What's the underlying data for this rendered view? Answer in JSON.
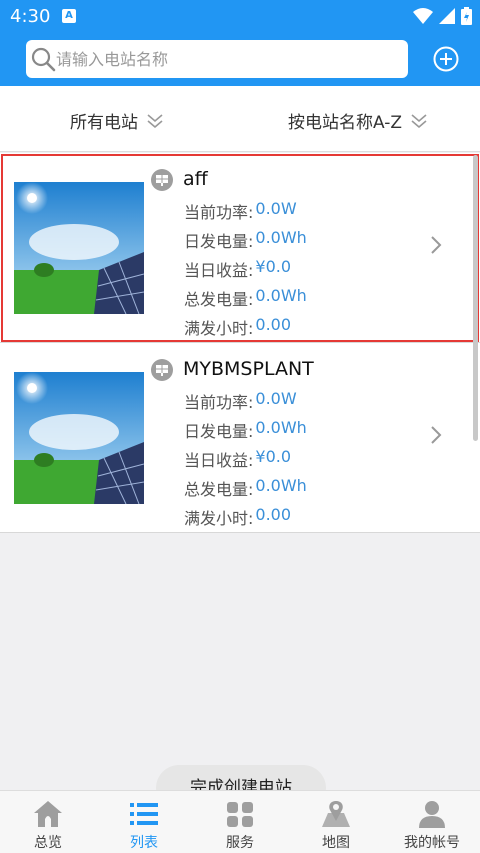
{
  "status_bar": {
    "time": "4:30",
    "notification_letter": "A"
  },
  "search": {
    "placeholder": "请输入电站名称",
    "value": ""
  },
  "filters": {
    "station_filter": "所有电站",
    "sort_filter": "按电站名称A-Z"
  },
  "stations": [
    {
      "name": "aff",
      "fields": [
        {
          "label": "当前功率:",
          "value": "0.0W"
        },
        {
          "label": "日发电量:",
          "value": "0.0Wh"
        },
        {
          "label": "当日收益:",
          "value": "¥0.0"
        },
        {
          "label": "总发电量:",
          "value": "0.0Wh"
        },
        {
          "label": "满发小时:",
          "value": "0.00"
        }
      ]
    },
    {
      "name": "MYBMSPLANT",
      "fields": [
        {
          "label": "当前功率:",
          "value": "0.0W"
        },
        {
          "label": "日发电量:",
          "value": "0.0Wh"
        },
        {
          "label": "当日收益:",
          "value": "¥0.0"
        },
        {
          "label": "总发电量:",
          "value": "0.0Wh"
        },
        {
          "label": "满发小时:",
          "value": "0.00"
        }
      ]
    }
  ],
  "toast": "完成创建电站",
  "nav": [
    {
      "label": "总览",
      "icon": "home-icon"
    },
    {
      "label": "列表",
      "icon": "list-icon"
    },
    {
      "label": "服务",
      "icon": "service-icon"
    },
    {
      "label": "地图",
      "icon": "map-icon"
    },
    {
      "label": "我的帐号",
      "icon": "account-icon"
    }
  ],
  "colors": {
    "primary": "#2196f3",
    "value_text": "#3a8fd8",
    "highlight_border": "#e53935"
  },
  "active_tab": 1
}
